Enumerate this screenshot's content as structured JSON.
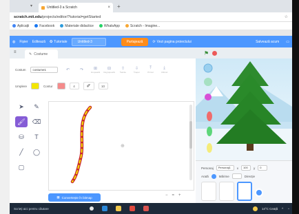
{
  "browser": {
    "tab_title": "Untitled-3 a Scratch",
    "tab_close": "×",
    "new_tab": "+",
    "url_host": "scratch.mit.edu",
    "url_path": "/projects/editor/?tutorial=getStarted",
    "address_icon": "star-icon"
  },
  "bookmarks": [
    {
      "label": "Aplicații",
      "color": "#4285f4"
    },
    {
      "label": "Facebook",
      "color": "#1877f2"
    },
    {
      "label": "Materiale didactice",
      "color": "#2d9cdb"
    },
    {
      "label": "WhatsApp",
      "color": "#25d366"
    },
    {
      "label": "Scratch - Imagine...",
      "color": "#f7a733"
    }
  ],
  "menubar": {
    "file": "Fișier",
    "edit": "Editează",
    "tutorials": "Tutoriale",
    "project_title": "Untitled-3",
    "share": "Partajează",
    "see_project": "Vezi pagina proiectului",
    "save_now": "Salvează acum"
  },
  "editor": {
    "costume_tab": "Costume",
    "costume_label": "Costum",
    "costume_name": "costume1",
    "buttons": [
      {
        "glyph": "↶",
        "caption": ""
      },
      {
        "glyph": "↷",
        "caption": ""
      },
      {
        "glyph": "⊞",
        "caption": "Grupează"
      },
      {
        "glyph": "⊟",
        "caption": "Degrupează"
      },
      {
        "glyph": "⇧",
        "caption": "Înainte"
      },
      {
        "glyph": "⇩",
        "caption": "Înapoi"
      },
      {
        "glyph": "⤒",
        "caption": "Primul"
      },
      {
        "glyph": "⤓",
        "caption": "Ultimul"
      }
    ],
    "fill_label": "Umplere",
    "outline_label": "Contur",
    "fill_color": "#f3e600",
    "outline_color": "#f58b8b",
    "outline_size": "4",
    "brush_size": "10",
    "convert_button": "Convertește în bitmap",
    "zoom_out": "−",
    "zoom_reset": "=",
    "zoom_in": "+"
  },
  "tools": [
    {
      "name": "select-tool",
      "glyph": "➤"
    },
    {
      "name": "reshape-tool",
      "glyph": "✎"
    },
    {
      "name": "brush-tool",
      "glyph": "🖌",
      "active": true
    },
    {
      "name": "eraser-tool",
      "glyph": "⌫"
    },
    {
      "name": "fill-tool",
      "glyph": "⛁"
    },
    {
      "name": "text-tool",
      "glyph": "T"
    },
    {
      "name": "line-tool",
      "glyph": "╱"
    },
    {
      "name": "circle-tool",
      "glyph": "◯"
    },
    {
      "name": "rectangle-tool",
      "glyph": "▢"
    }
  ],
  "sprite_panel": {
    "sprite_label": "Personaj",
    "sprite_name": "Personaj1",
    "x_label": "x",
    "x_value": "100",
    "y_label": "y",
    "y_value": "0",
    "show_label": "Arată",
    "size_label": "Mărime",
    "direction_label": "Direcție"
  },
  "taskbar": {
    "search_placeholder": "Scrieți aici pentru căutare",
    "weather": "14°C Ceață"
  }
}
